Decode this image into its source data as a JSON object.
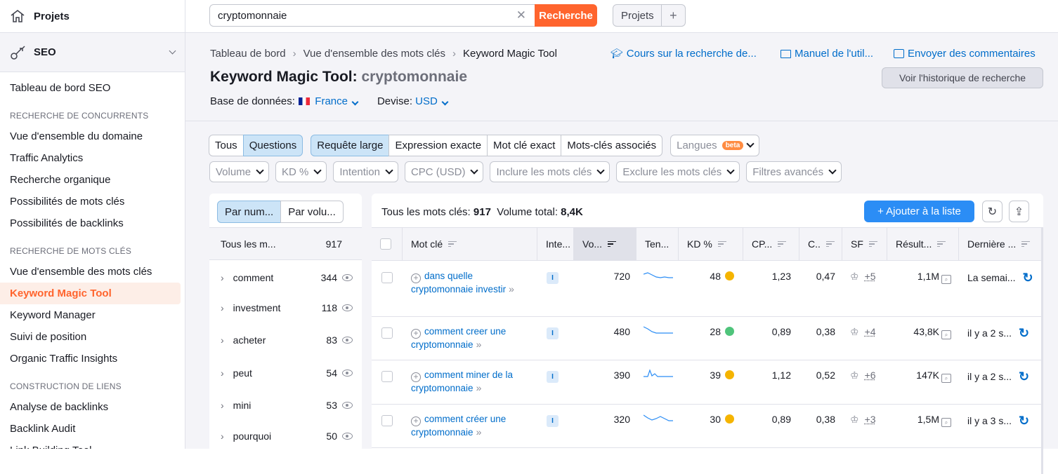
{
  "sidebar": {
    "projets": "Projets",
    "seo": "SEO",
    "items": [
      {
        "type": "item",
        "label": "Tableau de bord SEO"
      },
      {
        "type": "section",
        "label": "RECHERCHE DE CONCURRENTS"
      },
      {
        "type": "item",
        "label": "Vue d'ensemble du domaine"
      },
      {
        "type": "item",
        "label": "Traffic Analytics"
      },
      {
        "type": "item",
        "label": "Recherche organique"
      },
      {
        "type": "item",
        "label": "Possibilités de mots clés"
      },
      {
        "type": "item",
        "label": "Possibilités de backlinks"
      },
      {
        "type": "section",
        "label": "RECHERCHE DE MOTS CLÉS"
      },
      {
        "type": "item",
        "label": "Vue d'ensemble des mots clés"
      },
      {
        "type": "item",
        "label": "Keyword Magic Tool",
        "active": true
      },
      {
        "type": "item",
        "label": "Keyword Manager"
      },
      {
        "type": "item",
        "label": "Suivi de position"
      },
      {
        "type": "item",
        "label": "Organic Traffic Insights"
      },
      {
        "type": "section",
        "label": "CONSTRUCTION DE LIENS"
      },
      {
        "type": "item",
        "label": "Analyse de backlinks"
      },
      {
        "type": "item",
        "label": "Backlink Audit"
      },
      {
        "type": "item",
        "label": "Link Building Tool"
      }
    ]
  },
  "topbar": {
    "search_value": "cryptomonnaie",
    "search_button": "Recherche",
    "projets_button": "Projets",
    "plus": "+"
  },
  "header": {
    "breadcrumb": [
      "Tableau de bord",
      "Vue d'ensemble des mots clés",
      "Keyword Magic Tool"
    ],
    "links": {
      "course": "Cours sur la recherche de...",
      "manual": "Manuel de l'util...",
      "feedback": "Envoyer des commentaires"
    },
    "title_prefix": "Keyword Magic Tool:",
    "title_keyword": "cryptomonnaie",
    "history_button": "Voir l'historique de recherche",
    "db_label": "Base de données:",
    "db_value": "France",
    "currency_label": "Devise:",
    "currency_value": "USD"
  },
  "filters": {
    "group1": [
      "Tous",
      "Questions"
    ],
    "group2": [
      "Requête large",
      "Expression exacte",
      "Mot clé exact",
      "Mots-clés associés"
    ],
    "langues": "Langues",
    "beta": "beta",
    "dropdowns": [
      "Volume",
      "KD %",
      "Intention",
      "CPC (USD)",
      "Inclure les mots clés",
      "Exclure les mots clés",
      "Filtres avancés"
    ]
  },
  "left_panel": {
    "seg": [
      "Par num...",
      "Par volu..."
    ],
    "head_label": "Tous les m...",
    "head_count": "917",
    "groups": [
      {
        "kw": "comment",
        "count": "344"
      },
      {
        "kw": "investment",
        "count": "118"
      },
      {
        "kw": "acheter",
        "count": "83"
      },
      {
        "kw": "peut",
        "count": "54"
      },
      {
        "kw": "mini",
        "count": "53"
      },
      {
        "kw": "pourquoi",
        "count": "50"
      }
    ]
  },
  "table": {
    "summary_label": "Tous les mots clés:",
    "summary_count": "917",
    "volume_label": "Volume total:",
    "volume_value": "8,4K",
    "add_button": "+  Ajouter à la liste",
    "columns": [
      "Mot clé",
      "Inte...",
      "Vo...",
      "Ten...",
      "KD %",
      "CP...",
      "C..",
      "SF",
      "Résult...",
      "Dernière ..."
    ],
    "rows": [
      {
        "kw": "dans quelle cryptomonnaie investir",
        "intent": "I",
        "volume": "720",
        "kd": "48",
        "kd_color": "#f5b400",
        "cpc": "1,23",
        "com": "0,47",
        "sf": "+5",
        "results": "1,1M",
        "updated": "La semai..."
      },
      {
        "kw": "comment creer une cryptomonnaie",
        "intent": "I",
        "volume": "480",
        "kd": "28",
        "kd_color": "#4fc47b",
        "cpc": "0,89",
        "com": "0,38",
        "sf": "+4",
        "results": "43,8K",
        "updated": "il y a 2 s..."
      },
      {
        "kw": "comment miner de la cryptomonnaie",
        "intent": "I",
        "volume": "390",
        "kd": "39",
        "kd_color": "#f5b400",
        "cpc": "1,12",
        "com": "0,52",
        "sf": "+6",
        "results": "147K",
        "updated": "il y a 2 s..."
      },
      {
        "kw": "comment créer une cryptomonnaie",
        "intent": "I",
        "volume": "320",
        "kd": "30",
        "kd_color": "#f5b400",
        "cpc": "0,89",
        "com": "0,38",
        "sf": "+3",
        "results": "1,5M",
        "updated": "il y a 3 s..."
      }
    ]
  }
}
